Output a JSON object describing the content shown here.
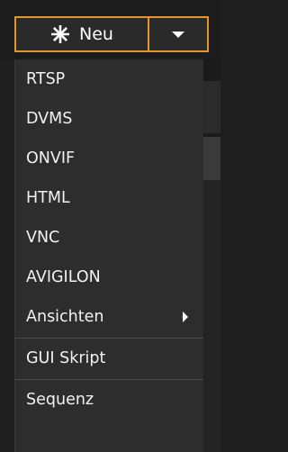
{
  "button": {
    "label": "Neu",
    "icon": "asterisk-icon",
    "dropdown_icon": "caret-down-icon",
    "accent_color": "#e3962b"
  },
  "menu": {
    "items": [
      {
        "label": "RTSP"
      },
      {
        "label": "DVMS"
      },
      {
        "label": "ONVIF"
      },
      {
        "label": "HTML"
      },
      {
        "label": "VNC"
      },
      {
        "label": "AVIGILON"
      },
      {
        "label": "Ansichten",
        "submenu_icon": "caret-right-icon"
      },
      {
        "label": "GUI Skript"
      },
      {
        "label": "Sequenz"
      }
    ]
  }
}
